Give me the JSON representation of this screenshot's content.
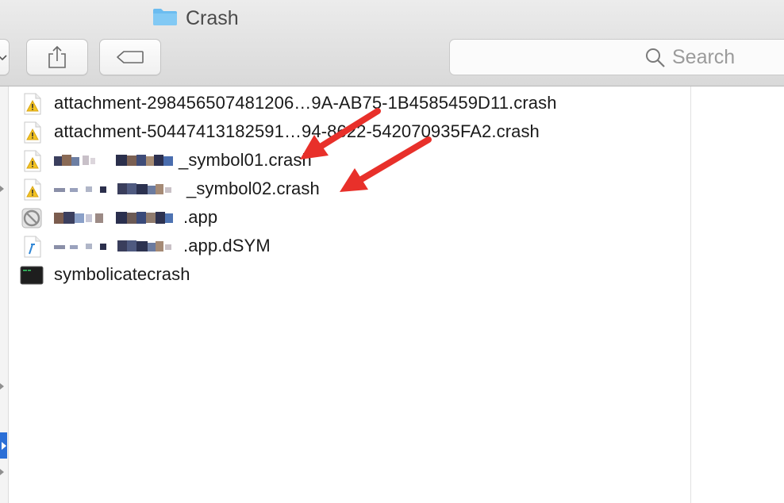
{
  "window": {
    "title": "Crash",
    "folder_icon": "folder-icon"
  },
  "toolbar": {
    "share_icon": "share-icon",
    "tag_icon": "tag-icon"
  },
  "search": {
    "placeholder": "Search",
    "icon": "magnifier-icon"
  },
  "files": [
    {
      "name": "attachment-298456507481206…9A-AB75-1B4585459D11.crash",
      "icon": "crash-report-warning-icon"
    },
    {
      "name": "attachment-50447413182591…94-8622-542070935FA2.crash",
      "icon": "crash-report-warning-icon"
    },
    {
      "name": "_symbol01.crash",
      "icon": "crash-report-warning-icon",
      "redacted_prefix": true
    },
    {
      "name": "_symbol02.crash",
      "icon": "crash-report-warning-icon",
      "redacted_prefix": true
    },
    {
      "name": ".app",
      "icon": "app-disabled-icon",
      "redacted_prefix": true
    },
    {
      "name": ".app.dSYM",
      "icon": "dsym-file-icon",
      "redacted_prefix": true
    },
    {
      "name": "symbolicatecrash",
      "icon": "terminal-executable-icon"
    }
  ],
  "annotations": {
    "arrow_color": "#e8302a"
  },
  "colors": {
    "selection_accent": "#2b6fd6",
    "folder_blue": "#6bbcf0"
  }
}
